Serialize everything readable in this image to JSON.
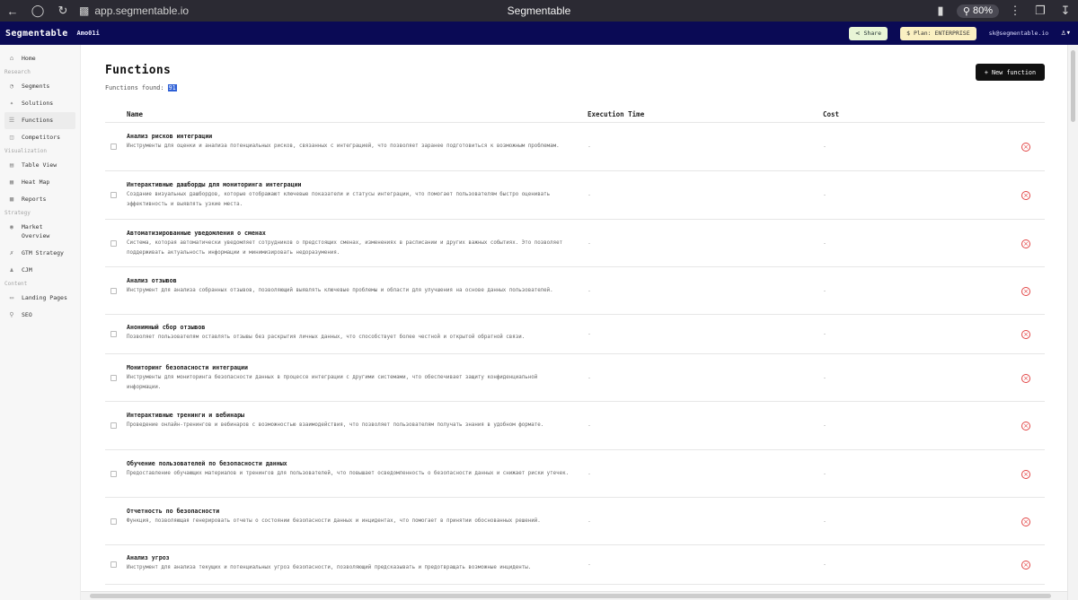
{
  "browser": {
    "url": "app.segmentable.io",
    "title": "Segmentable",
    "zoom": "80%"
  },
  "header": {
    "logo": "Segmentable",
    "project": "Amo01i",
    "share_label": "Share",
    "plan_label": "Plan: ENTERPRISE",
    "email": "sk@segmentable.io",
    "accent": "#0a0a55"
  },
  "sidebar": {
    "home": "Home",
    "sections": [
      {
        "title": "Research",
        "items": [
          "Segments",
          "Solutions",
          "Functions",
          "Competitors"
        ]
      },
      {
        "title": "Visualization",
        "items": [
          "Table View",
          "Heat Map",
          "Reports"
        ]
      },
      {
        "title": "Strategy",
        "items": [
          "Market Overview",
          "GTM Strategy",
          "CJM"
        ]
      },
      {
        "title": "Content",
        "items": [
          "Landing Pages",
          "SEO"
        ]
      }
    ],
    "active": "Functions"
  },
  "main": {
    "title": "Functions",
    "found_label": "Functions found:",
    "found_count": "91",
    "new_button": "New function",
    "columns": [
      "Name",
      "Execution Time",
      "Cost"
    ],
    "rows": [
      {
        "title": "Анализ рисков интеграции",
        "desc": "Инструменты для оценки и анализа потенциальных рисков, связанных с интеграцией, что позволяет заранее подготовиться к возможным проблемам.",
        "exec": "-",
        "cost": "-"
      },
      {
        "title": "Интерактивные дашборды для мониторинга интеграции",
        "desc": "Создание визуальных дашбордов, которые отображают ключевые показатели и статусы интеграции, что помогает пользователям быстро оценивать эффективность и выявлять узкие места.",
        "exec": "-",
        "cost": "-"
      },
      {
        "title": "Автоматизированные уведомления о сменах",
        "desc": "Система, которая автоматически уведомляет сотрудников о предстоящих сменах, изменениях в расписании и других важных событиях. Это позволяет поддерживать актуальность информации и минимизировать недоразумения.",
        "exec": "-",
        "cost": "-"
      },
      {
        "title": "Анализ отзывов",
        "desc": "Инструмент для анализа собранных отзывов, позволяющий выявлять ключевые проблемы и области для улучшения на основе данных пользователей.",
        "exec": "-",
        "cost": "-"
      },
      {
        "title": "Анонимный сбор отзывов",
        "desc": "Позволяет пользователям оставлять отзывы без раскрытия личных данных, что способствует более честной и открытой обратной связи.",
        "exec": "-",
        "cost": "-"
      },
      {
        "title": "Мониторинг безопасности интеграции",
        "desc": "Инструменты для мониторинга безопасности данных в процессе интеграции с другими системами, что обеспечивает защиту конфиденциальной информации.",
        "exec": "-",
        "cost": "-"
      },
      {
        "title": "Интерактивные тренинги и вебинары",
        "desc": "Проведение онлайн-тренингов и вебинаров с возможностью взаимодействия, что позволяет пользователям получать знания в удобном формате.",
        "exec": "-",
        "cost": "-"
      },
      {
        "title": "Обучение пользователей по безопасности данных",
        "desc": "Предоставление обучающих материалов и тренингов для пользователей, что повышает осведомленность о безопасности данных и снижает риски утечек.",
        "exec": "-",
        "cost": "-"
      },
      {
        "title": "Отчетность по безопасности",
        "desc": "Функция, позволяющая генерировать отчеты о состоянии безопасности данных и инцидентах, что помогает в принятии обоснованных решений.",
        "exec": "-",
        "cost": "-"
      },
      {
        "title": "Анализ угроз",
        "desc": "Инструмент для анализа текущих и потенциальных угроз безопасности, позволяющий предсказывать и предотвращать возможные инциденты.",
        "exec": "-",
        "cost": "-"
      }
    ]
  }
}
